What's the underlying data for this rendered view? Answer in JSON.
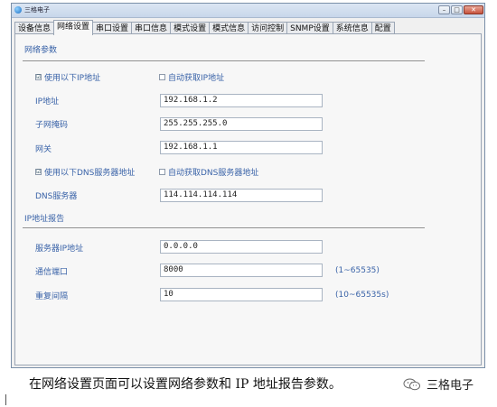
{
  "window": {
    "title": "三格电子",
    "buttons": {
      "minimize": "–",
      "maximize": "□",
      "close": "✕"
    }
  },
  "tabs": [
    {
      "label": "设备信息",
      "active": false
    },
    {
      "label": "网络设置",
      "active": true
    },
    {
      "label": "串口设置",
      "active": false
    },
    {
      "label": "串口信息",
      "active": false
    },
    {
      "label": "模式设置",
      "active": false
    },
    {
      "label": "模式信息",
      "active": false
    },
    {
      "label": "访问控制",
      "active": false
    },
    {
      "label": "SNMP设置",
      "active": false
    },
    {
      "label": "系统信息",
      "active": false
    },
    {
      "label": "配置",
      "active": false
    }
  ],
  "network": {
    "section_title": "网络参数",
    "use_static_ip": {
      "label": "使用以下IP地址",
      "checked": true,
      "mark": "☑"
    },
    "auto_ip": {
      "label": "自动获取IP地址",
      "checked": false,
      "mark": ""
    },
    "ip": {
      "label": "IP地址",
      "value": "192.168.1.2"
    },
    "mask": {
      "label": "子网掩码",
      "value": "255.255.255.0"
    },
    "gateway": {
      "label": "网关",
      "value": "192.168.1.1"
    },
    "use_static_dns": {
      "label": "使用以下DNS服务器地址",
      "checked": true,
      "mark": "☑"
    },
    "auto_dns": {
      "label": "自动获取DNS服务器地址",
      "checked": false,
      "mark": ""
    },
    "dns": {
      "label": "DNS服务器",
      "value": "114.114.114.114"
    }
  },
  "report": {
    "section_title": "IP地址报告",
    "server_ip": {
      "label": "服务器IP地址",
      "value": "0.0.0.0"
    },
    "port": {
      "label": "通信端口",
      "value": "8000",
      "hint": "(1~65535)"
    },
    "interval": {
      "label": "重复间隔",
      "value": "10",
      "hint": "(10~65535s)"
    }
  },
  "caption": "在网络设置页面可以设置网络参数和 IP 地址报告参数。",
  "brand": {
    "name": "三格电子",
    "icon": "wechat-icon"
  },
  "colors": {
    "label": "#3a63a8",
    "title_bar": "#c7d6ea",
    "panel": "#f7f7f7"
  }
}
